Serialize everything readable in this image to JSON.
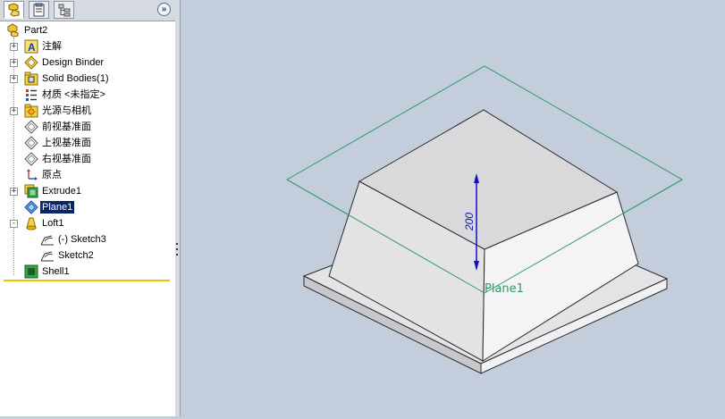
{
  "tabs": [
    {
      "name": "featuremanager-tab",
      "icon": "featuremanager-icon",
      "active": true
    },
    {
      "name": "propertymanager-tab",
      "icon": "propertymanager-icon",
      "active": false
    },
    {
      "name": "configurationmanager-tab",
      "icon": "configurationmanager-icon",
      "active": false
    }
  ],
  "expand_button": {
    "label": "»"
  },
  "tree": {
    "root": {
      "label": "Part2",
      "icon": "part-icon"
    },
    "items": [
      {
        "label": "注解",
        "icon": "annotations-icon",
        "expander": "+"
      },
      {
        "label": "Design Binder",
        "icon": "design-binder-icon",
        "expander": "+"
      },
      {
        "label": "Solid Bodies(1)",
        "icon": "solid-bodies-icon",
        "expander": "+"
      },
      {
        "label": "材质 <未指定>",
        "icon": "material-icon",
        "expander": ""
      },
      {
        "label": "光源与相机",
        "icon": "lights-cameras-icon",
        "expander": "+"
      },
      {
        "label": "前视基准面",
        "icon": "plane-icon",
        "expander": ""
      },
      {
        "label": "上视基准面",
        "icon": "plane-icon",
        "expander": ""
      },
      {
        "label": "右视基准面",
        "icon": "plane-icon",
        "expander": ""
      },
      {
        "label": "原点",
        "icon": "origin-icon",
        "expander": ""
      },
      {
        "label": "Extrude1",
        "icon": "extrude-icon",
        "expander": "+"
      },
      {
        "label": "Plane1",
        "icon": "plane-selected-icon",
        "expander": "",
        "selected": true
      },
      {
        "label": "Loft1",
        "icon": "loft-icon",
        "expander": "-"
      },
      {
        "label": "(-) Sketch3",
        "icon": "sketch-icon",
        "expander": "",
        "child": true
      },
      {
        "label": "Sketch2",
        "icon": "sketch-icon",
        "expander": "",
        "child": true
      },
      {
        "label": "Shell1",
        "icon": "shell-icon",
        "expander": ""
      }
    ]
  },
  "viewport": {
    "plane_label": "Plane1",
    "dimension_value": "200",
    "colors": {
      "plane": "#2e9a63",
      "dimension": "#1010c0",
      "top_face": "#d9d9db",
      "left_face": "#e3e3e5",
      "right_face": "#f4f4f6",
      "base_top": "#e4e4e6",
      "edge": "#2a2a2a"
    }
  }
}
